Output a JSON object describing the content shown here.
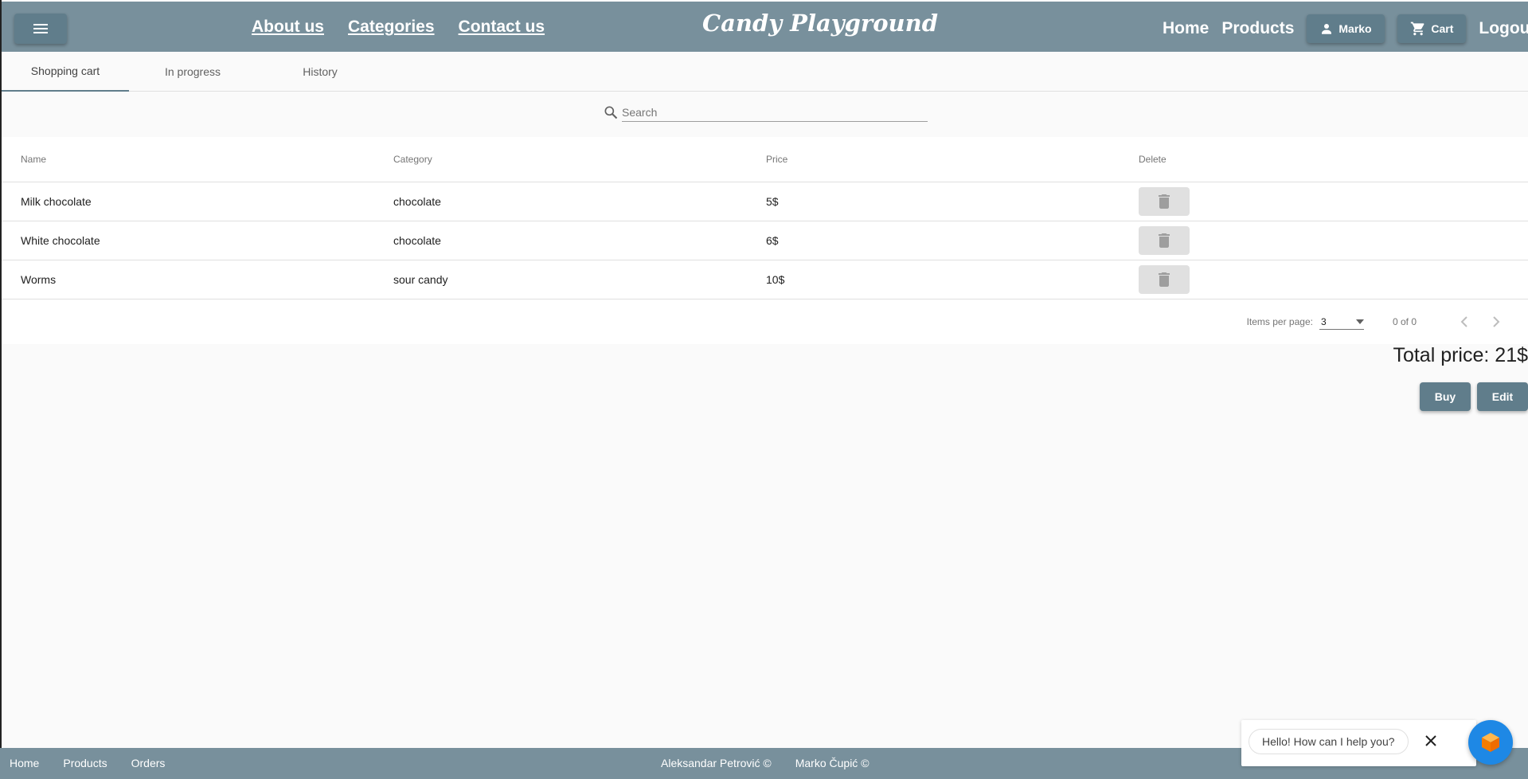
{
  "header": {
    "menu_icon": "hamburger-menu-icon",
    "nav_links": [
      "About us",
      "Categories",
      "Contact us"
    ],
    "brand": "Candy Playground",
    "home": "Home",
    "products": "Products",
    "user_name": "Marko",
    "cart_label": "Cart",
    "logout": "Logout"
  },
  "tabs": [
    "Shopping cart",
    "In progress",
    "History"
  ],
  "active_tab": "Shopping cart",
  "search": {
    "placeholder": "Search",
    "value": ""
  },
  "table": {
    "columns": [
      "Name",
      "Category",
      "Price",
      "Delete"
    ],
    "rows": [
      {
        "name": "Milk chocolate",
        "category": "chocolate",
        "price": "5$"
      },
      {
        "name": "White chocolate",
        "category": "chocolate",
        "price": "6$"
      },
      {
        "name": "Worms",
        "category": "sour candy",
        "price": "10$"
      }
    ]
  },
  "paginator": {
    "items_per_page_label": "Items per page:",
    "items_per_page_value": "3",
    "range_label": "0 of 0"
  },
  "total": "Total price: 21$",
  "actions": {
    "buy": "Buy",
    "edit": "Edit"
  },
  "footer": {
    "links": [
      "Home",
      "Products",
      "Orders"
    ],
    "credits": [
      "Aleksandar Petrović ©",
      "Marko Čupić ©"
    ]
  },
  "chat": {
    "message": "Hello! How can I help you?"
  },
  "colors": {
    "header_bg": "#78909c",
    "button_bg": "#607d8b",
    "page_bg": "#fafafa",
    "chat_launcher": "#1e88e5"
  }
}
